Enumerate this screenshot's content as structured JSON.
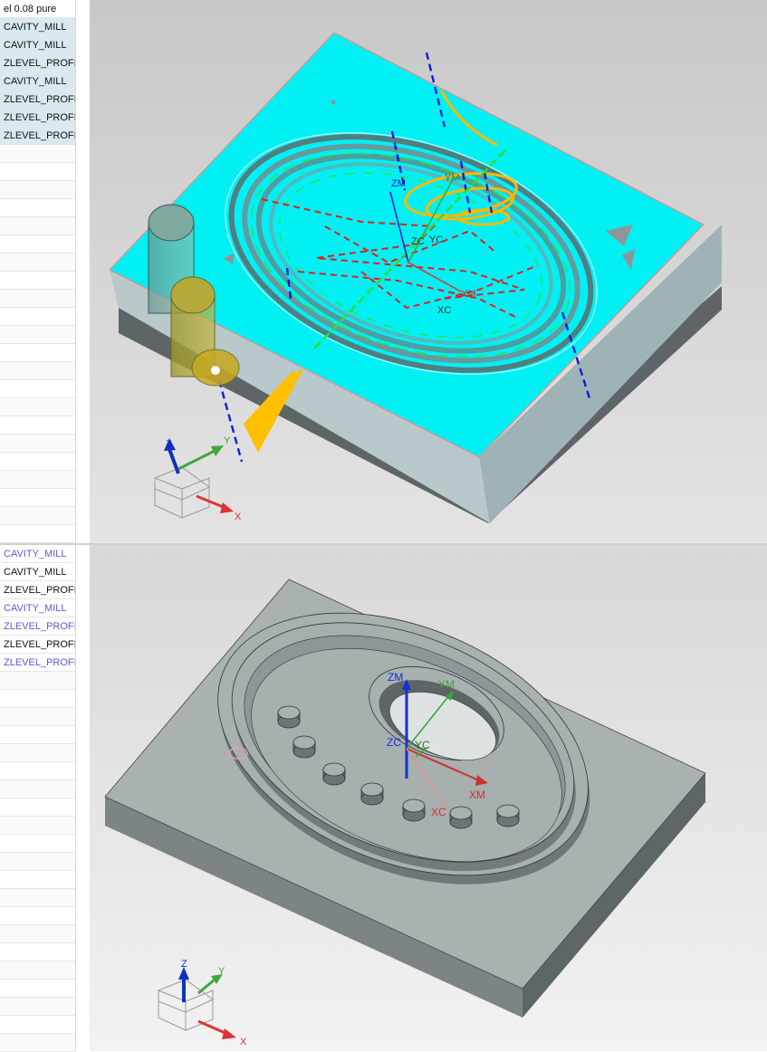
{
  "top_list": {
    "header": "el 0.08 pure",
    "items": [
      "CAVITY_MILL",
      "CAVITY_MILL",
      "ZLEVEL_PROFI…",
      "CAVITY_MILL",
      "ZLEVEL_PROFI…",
      "ZLEVEL_PROFI…",
      "ZLEVEL_PROFI…"
    ]
  },
  "bottom_list": {
    "items": [
      {
        "label": "CAVITY_MILL",
        "style": "link"
      },
      {
        "label": "CAVITY_MILL",
        "style": "plain"
      },
      {
        "label": "ZLEVEL_PROFI…",
        "style": "plain"
      },
      {
        "label": "CAVITY_MILL",
        "style": "link"
      },
      {
        "label": "ZLEVEL_PROFI…",
        "style": "link"
      },
      {
        "label": "ZLEVEL_PROFI…",
        "style": "plain"
      },
      {
        "label": "ZLEVEL_PROFI…",
        "style": "link"
      }
    ]
  },
  "top_viewport": {
    "csys_labels": {
      "zm": "ZM",
      "ym": "YM",
      "zc": "ZC",
      "yc": "YC",
      "xm": "XM",
      "xc": "XC"
    },
    "triad": {
      "x": "X",
      "y": "Y",
      "z": "Z"
    }
  },
  "bottom_viewport": {
    "csys_labels": {
      "zm": "ZM",
      "ym": "YM",
      "zc": "ZC",
      "yc": "YC",
      "xm": "XM",
      "xc": "XC"
    },
    "triad": {
      "x": "X",
      "y": "Y",
      "z": "Z"
    }
  },
  "colors": {
    "stock_top": "#00ffff",
    "stock_side": "#b7c8cc",
    "stock_front": "#a8bbc0",
    "base_dark": "#6b7273",
    "part_top": "#aab2b2",
    "part_side": "#6e7676",
    "toolpath_yellow": "#ffc000",
    "blue_axis": "#0a1fd6",
    "red_axis": "#e03232",
    "green_axis": "#3bbf2a",
    "bg_top": "#d4d4d4",
    "bg_bottom": "#f0f0f0"
  },
  "icons": [
    "tool-cylinder-icon",
    "csys-triad-icon"
  ]
}
